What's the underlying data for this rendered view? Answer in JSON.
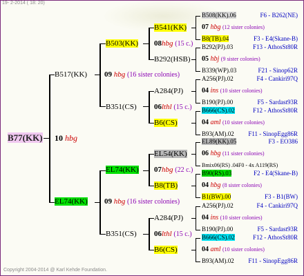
{
  "header": {
    "date": "19- 2-2014 ( 18: 20)"
  },
  "footer": {
    "copyright": "Copyright 2004-2014 @ Karl Kehde Foundation."
  },
  "queen": {
    "name": "B77(KK)",
    "year": "10",
    "mark": "hbg"
  },
  "gen2": [
    {
      "name": "B517(KK)",
      "year": "09",
      "mark": "hbg",
      "sisters": "(16 sister colonies)"
    },
    {
      "name": "EL74(KK)",
      "year": "09",
      "mark": "hbg",
      "sisters": "(16 sister colonies)"
    }
  ],
  "gen3": [
    {
      "name": "B503(KK)",
      "year": "08",
      "mark": "hbg",
      "sisters": "(15 c.)"
    },
    {
      "name": "B351(CS)",
      "year": "06",
      "mark": "lthl",
      "sisters": "(15 c.)"
    },
    {
      "name": "EL74(KK)",
      "year": "07",
      "mark": "hbg",
      "sisters": "(22 c.)"
    },
    {
      "name": "B351(CS)",
      "year": "06",
      "mark": "lthl",
      "sisters": "(15 c.)"
    }
  ],
  "gen4": [
    {
      "name": "B541(KK)"
    },
    {
      "name": "B292(HSB)"
    },
    {
      "name": "A284(PJ)"
    },
    {
      "name": "B6(CS)"
    },
    {
      "name": "EL54(KK)"
    },
    {
      "name": "B8(TB)"
    },
    {
      "name": "A284(PJ)"
    },
    {
      "name": "B6(CS)"
    }
  ],
  "gen5": [
    {
      "type": "anc",
      "name": "B508(KK)",
      "year": ".06",
      "code": "F6 - B262(NE)"
    },
    {
      "type": "sis",
      "year": "07",
      "mark": "hbg",
      "sisters": "(12 sister colonies)"
    },
    {
      "type": "anc",
      "name": "B8(TB)",
      "year": ".04",
      "code": "F3 - E4(Skane-B)"
    },
    {
      "type": "anc",
      "name": "B292(PJ)",
      "year": ".03",
      "code": "F13 - AthosSt80R"
    },
    {
      "type": "sis",
      "year": "05",
      "mark": "hbj",
      "sisters": "(9 sister colonies)"
    },
    {
      "type": "anc",
      "name": "B339(WP)",
      "year": ".03",
      "code": "F21 - Sinop62R"
    },
    {
      "type": "anc",
      "name": "A256(PJ)",
      "year": ".02",
      "code": "F4 - Cankiri97Q"
    },
    {
      "type": "sis",
      "year": "04",
      "mark": "ins",
      "sisters": "(10 sister colonies)"
    },
    {
      "type": "anc",
      "name": "B190(PJ)",
      "year": ".00",
      "code": "F5 - Sardast93R"
    },
    {
      "type": "anc",
      "name": "B666(CS)",
      "year": ".02",
      "code": "F12 - AthosSt80R"
    },
    {
      "type": "sis",
      "year": "04",
      "mark": "aml",
      "sisters": "(10 sister colonies)"
    },
    {
      "type": "anc",
      "name": "B93(AM)",
      "year": ".02",
      "code": "F11 - SinopEgg86R"
    },
    {
      "type": "anc",
      "name": "EL89(KK)",
      "year": ".05",
      "code": "F3 - EO386"
    },
    {
      "type": "sis",
      "year": "06",
      "mark": "hbg",
      "sisters": "(11 sister colonies)"
    },
    {
      "type": "pm",
      "text": "Bmix06(RS) .04F0 - 4x A119(RS)"
    },
    {
      "type": "anc",
      "name": "B90(RS)",
      "year": ".03",
      "code": "F2 - E4(Skane-B)"
    },
    {
      "type": "sis",
      "year": "04",
      "mark": "hbg",
      "sisters": "(8 sister colonies)"
    },
    {
      "type": "anc",
      "name": "B1(BW)",
      "year": ".00",
      "code": "F3 - B1(BW)"
    },
    {
      "type": "anc",
      "name": "A256(PJ)",
      "year": ".02",
      "code": "F4 - Cankiri97Q"
    },
    {
      "type": "sis",
      "year": "04",
      "mark": "ins",
      "sisters": "(10 sister colonies)"
    },
    {
      "type": "anc",
      "name": "B190(PJ)",
      "year": ".00",
      "code": "F5 - Sardast93R"
    },
    {
      "type": "anc",
      "name": "B666(CS)",
      "year": ".02",
      "code": "F12 - AthosSt80R"
    },
    {
      "type": "sis",
      "year": "04",
      "mark": "aml",
      "sisters": "(10 sister colonies)"
    },
    {
      "type": "anc",
      "name": "B93(AM)",
      "year": ".02",
      "code": "F11 - SinopEgg86R"
    }
  ]
}
